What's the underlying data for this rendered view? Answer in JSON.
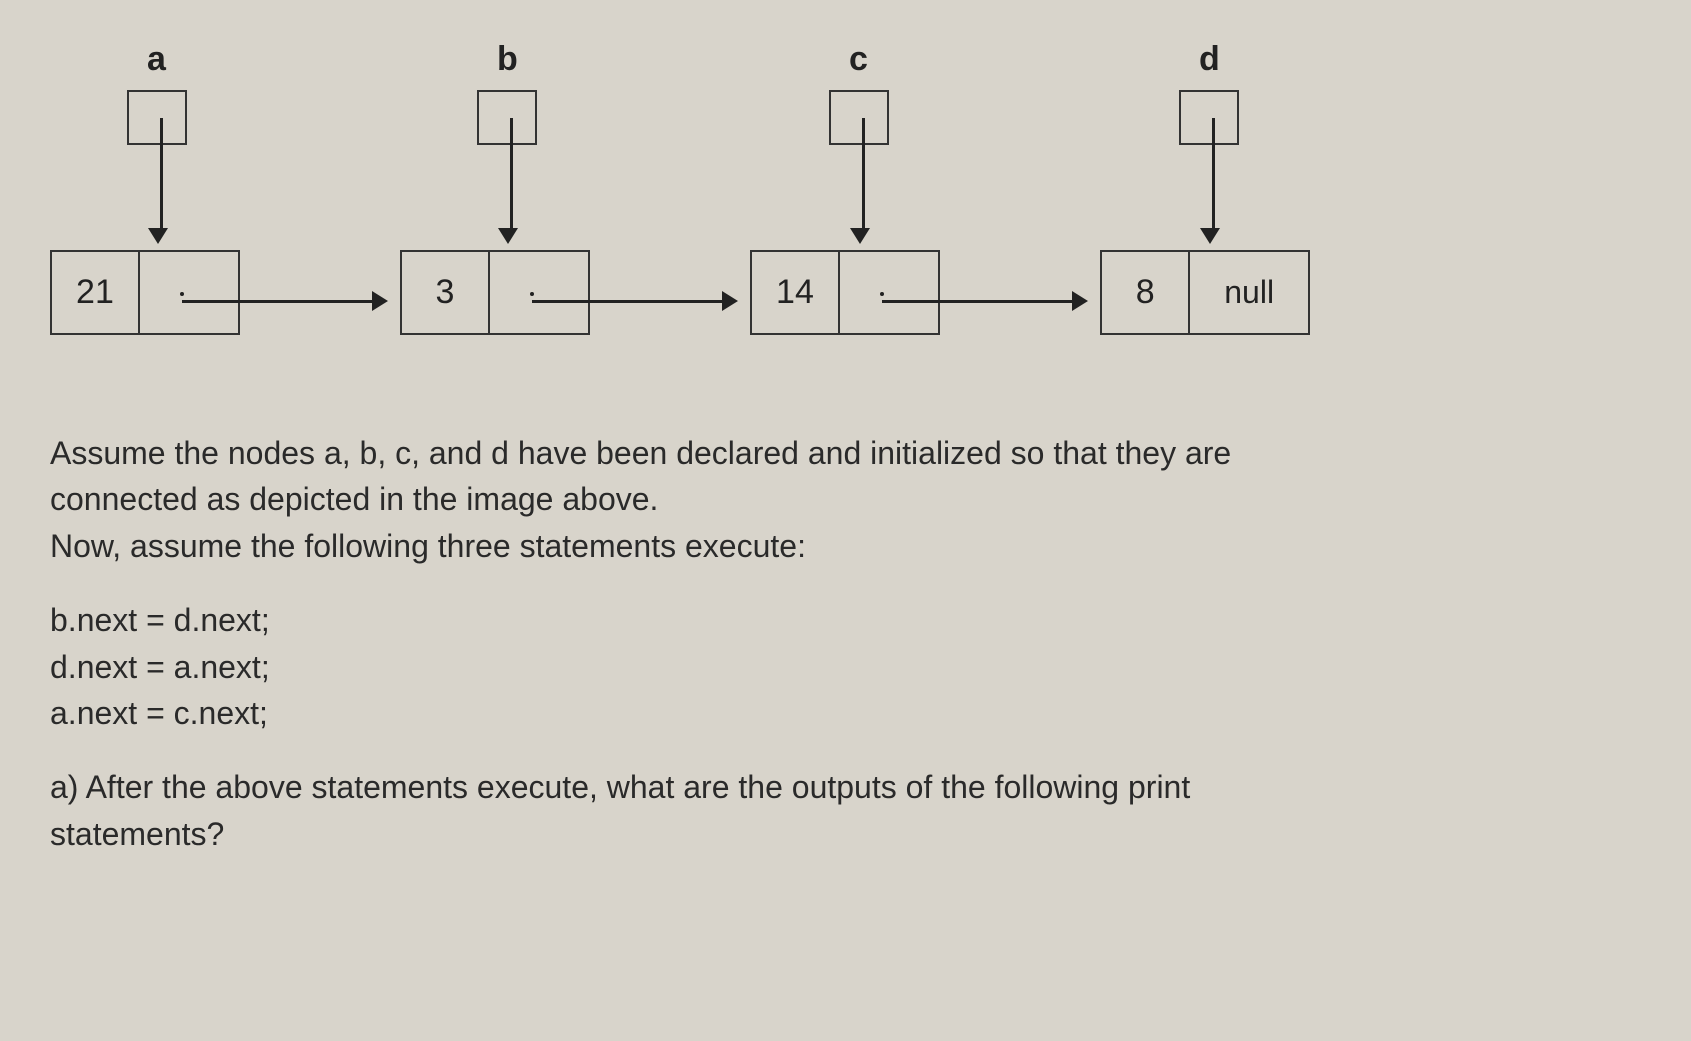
{
  "pointers": {
    "a": {
      "label": "a"
    },
    "b": {
      "label": "b"
    },
    "c": {
      "label": "c"
    },
    "d": {
      "label": "d"
    }
  },
  "nodes": {
    "a": {
      "value": "21",
      "next_label": ""
    },
    "b": {
      "value": "3",
      "next_label": ""
    },
    "c": {
      "value": "14",
      "next_label": ""
    },
    "d": {
      "value": "8",
      "next_label": "null"
    }
  },
  "text": {
    "intro_line1": "Assume the nodes a, b, c, and d have been declared and initialized so that they are",
    "intro_line2": "connected as depicted in the image above.",
    "intro_line3": "Now, assume the following three statements execute:",
    "stmt1": "b.next = d.next;",
    "stmt2": "d.next = a.next;",
    "stmt3": "a.next = c.next;",
    "question_line1": "a) After the above statements execute, what are the outputs of the following print",
    "question_line2": "statements?"
  }
}
